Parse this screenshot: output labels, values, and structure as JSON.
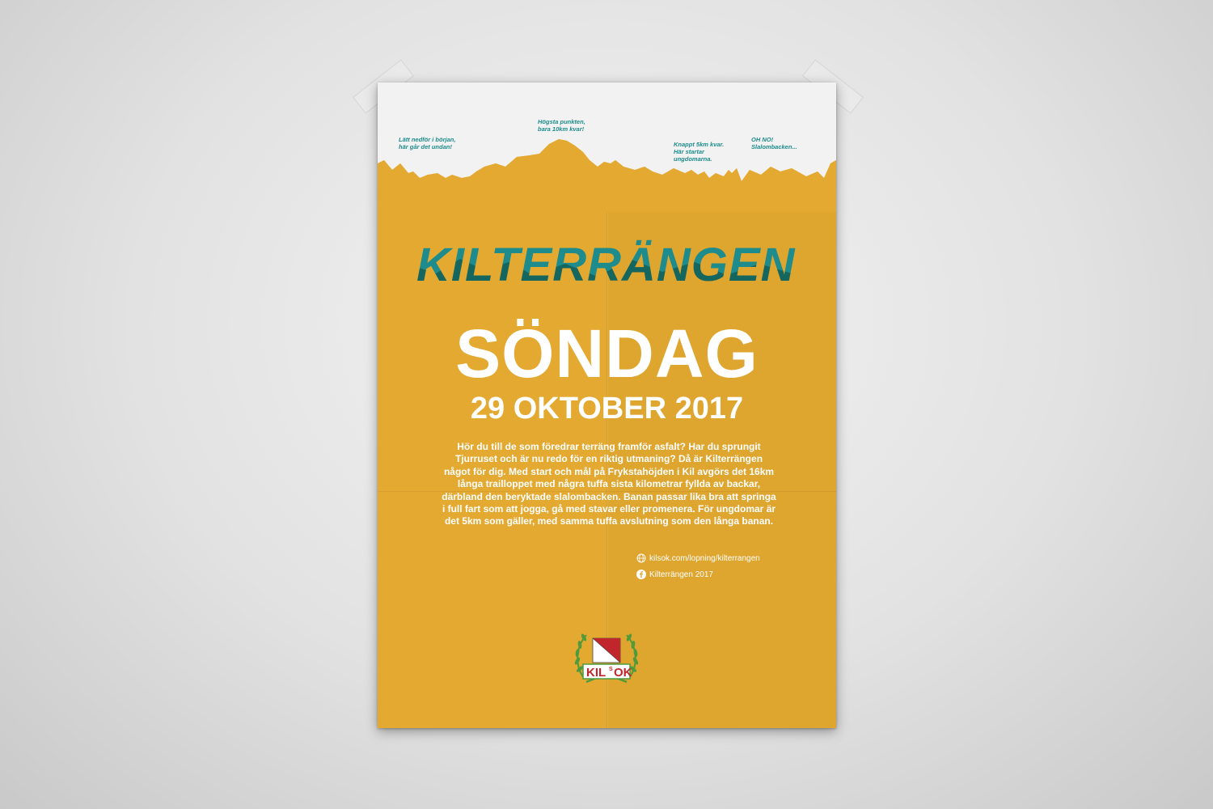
{
  "poster": {
    "notes": [
      "Lätt nedför i början, här går det undan!",
      "Högsta punkten, bara 10km kvar!",
      "Knappt 5km kvar. Här startar ungdomarna.",
      "OH NO! Slalombacken..."
    ],
    "title": "KILTERRÄNGEN",
    "day": "SÖNDAG",
    "date": "29 OKTOBER 2017",
    "description": "Hör du till de som föredrar terräng framför asfalt? Har du sprungit Tjurruset och är nu redo för en riktig utmaning? Då är Kilterrängen något för dig. Med start och mål på Frykstahöjden i Kil avgörs det 16km långa trailloppet med några tuffa sista kilometrar fyllda av backar, därbland den beryktade slalombacken. Banan passar lika bra att springa i full fart som att jogga, gå med stavar eller promenera. För ungdomar är det 5km som gäller, med samma tuffa avslutning som den långa banan.",
    "website": "kilsok.com/lopning/kilterrangen",
    "facebook": "Kilterrängen 2017",
    "logo": {
      "left": "KIL",
      "small": "S",
      "right": "OK"
    }
  },
  "colors": {
    "background": "#e4a931",
    "teal": "#1e8c8c",
    "dark_teal": "#15665f",
    "snow": "#f2f2f2",
    "text": "#ffffff",
    "logo_red": "#c0262c",
    "logo_green": "#4f9a3b"
  },
  "icons": [
    "globe-icon",
    "facebook-icon",
    "laurel-icon",
    "diagonal-flag-icon"
  ]
}
